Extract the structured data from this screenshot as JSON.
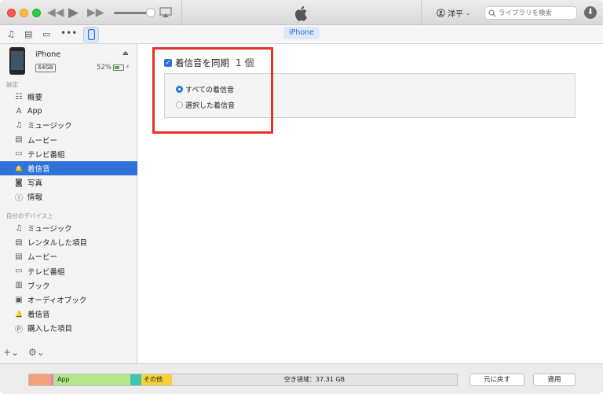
{
  "toolbar": {
    "rewind_icon": "rewind-icon",
    "play_icon": "play-icon",
    "forward_icon": "fast-forward-icon",
    "account_name": "洋平",
    "search_placeholder": "ライブラリを検索"
  },
  "device_tab": "iPhone",
  "device": {
    "name": "iPhone",
    "capacity": "64GB",
    "battery_percent": "52%",
    "battery_level": 0.52
  },
  "sidebar": {
    "settings_header": "設定",
    "settings_items": [
      {
        "label": "概要",
        "icon": "summary-icon"
      },
      {
        "label": "App",
        "icon": "app-store-icon"
      },
      {
        "label": "ミュージック",
        "icon": "music-note-icon"
      },
      {
        "label": "ムービー",
        "icon": "film-icon"
      },
      {
        "label": "テレビ番組",
        "icon": "tv-icon"
      },
      {
        "label": "着信音",
        "icon": "bell-icon",
        "active": true
      },
      {
        "label": "写真",
        "icon": "camera-icon"
      },
      {
        "label": "情報",
        "icon": "info-icon"
      }
    ],
    "on_device_header": "自分のデバイス上",
    "on_device_items": [
      {
        "label": "ミュージック",
        "icon": "music-note-icon"
      },
      {
        "label": "レンタルした項目",
        "icon": "film-icon"
      },
      {
        "label": "ムービー",
        "icon": "film-icon"
      },
      {
        "label": "テレビ番組",
        "icon": "tv-icon"
      },
      {
        "label": "ブック",
        "icon": "book-icon"
      },
      {
        "label": "オーディオブック",
        "icon": "audiobook-icon"
      },
      {
        "label": "着信音",
        "icon": "bell-icon"
      },
      {
        "label": "購入した項目",
        "icon": "purchased-icon"
      }
    ]
  },
  "main": {
    "sync_label": "着信音を同期",
    "sync_count": "1 個",
    "sync_checked": true,
    "options": [
      {
        "label": "すべての着信音",
        "selected": true
      },
      {
        "label": "選択した着信音",
        "selected": false
      }
    ]
  },
  "storage": {
    "app_label": "App",
    "other_label": "その他",
    "free_label": "空き領域：37.31 GB",
    "colors": {
      "audio": "#f2a27a",
      "app": "#b6e58a",
      "teal": "#3dc5b0",
      "other": "#f8d13a",
      "free": "#e3e3e3"
    }
  },
  "buttons": {
    "revert": "元に戻す",
    "apply": "適用"
  },
  "colors": {
    "accent": "#2f72d8",
    "highlight_box": "#e8312c"
  }
}
